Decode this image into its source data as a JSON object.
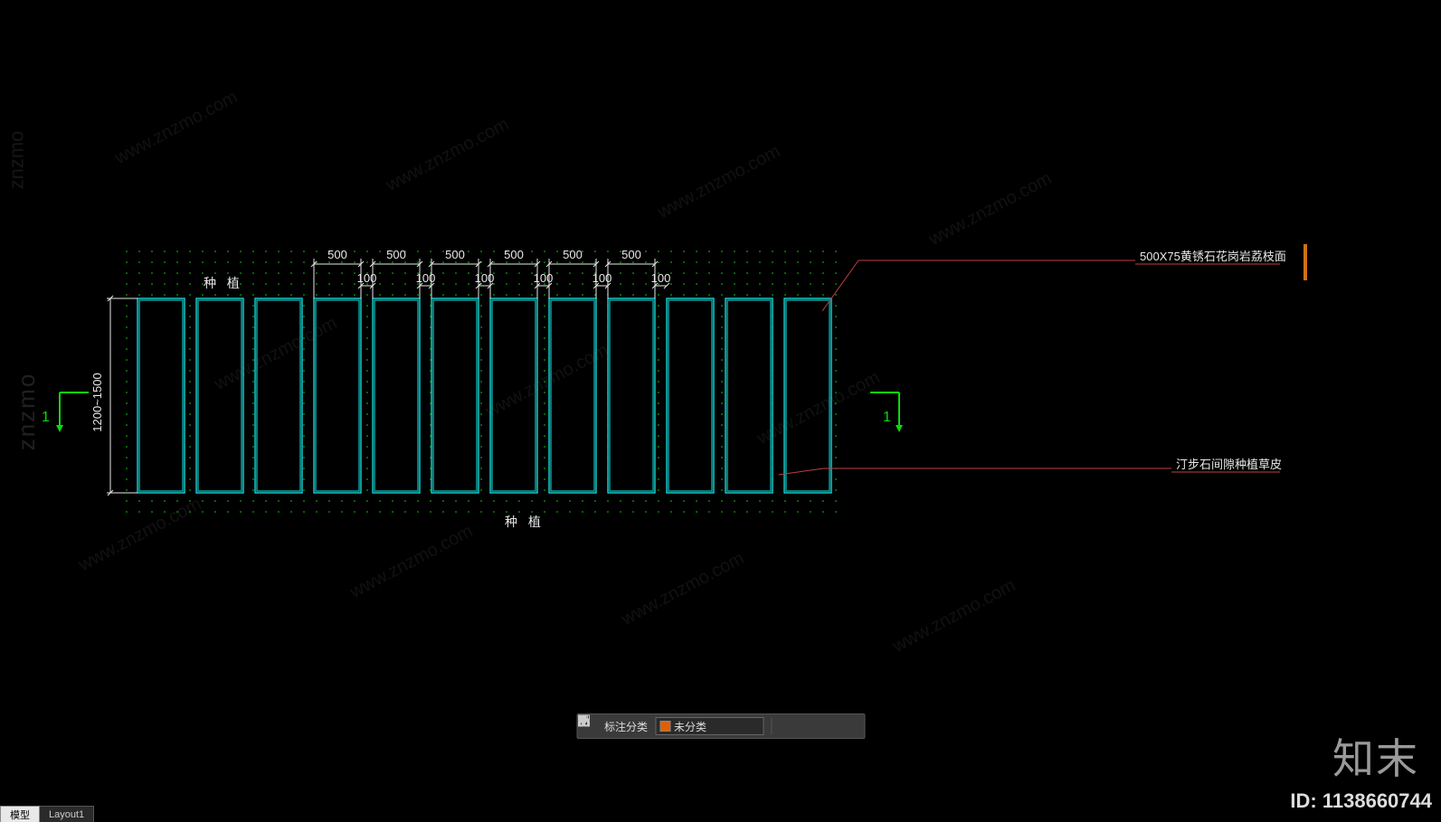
{
  "tabs": [
    {
      "label": "模型",
      "active": true
    },
    {
      "label": "Layout1",
      "active": false
    }
  ],
  "toolbar": {
    "label": "标注分类",
    "dropdown": {
      "swatch": "#e06000",
      "value": "未分类"
    }
  },
  "drawing": {
    "top_dims": [
      "500",
      "500",
      "500",
      "500",
      "500",
      "500"
    ],
    "gap_dims": [
      "100",
      "100",
      "100",
      "100",
      "100",
      "100"
    ],
    "left_dim": "1200~1500",
    "text_top": "种   植",
    "text_bottom": "种   植",
    "section_mark": "1",
    "annotations": [
      "500X75黄锈石花岗岩荔枝面",
      "汀步石间隙种植草皮"
    ]
  },
  "watermark_url": "www.znzmo.com",
  "brand_text": "知末",
  "side_wm": "znzmo",
  "asset_id": "ID: 1138660744"
}
